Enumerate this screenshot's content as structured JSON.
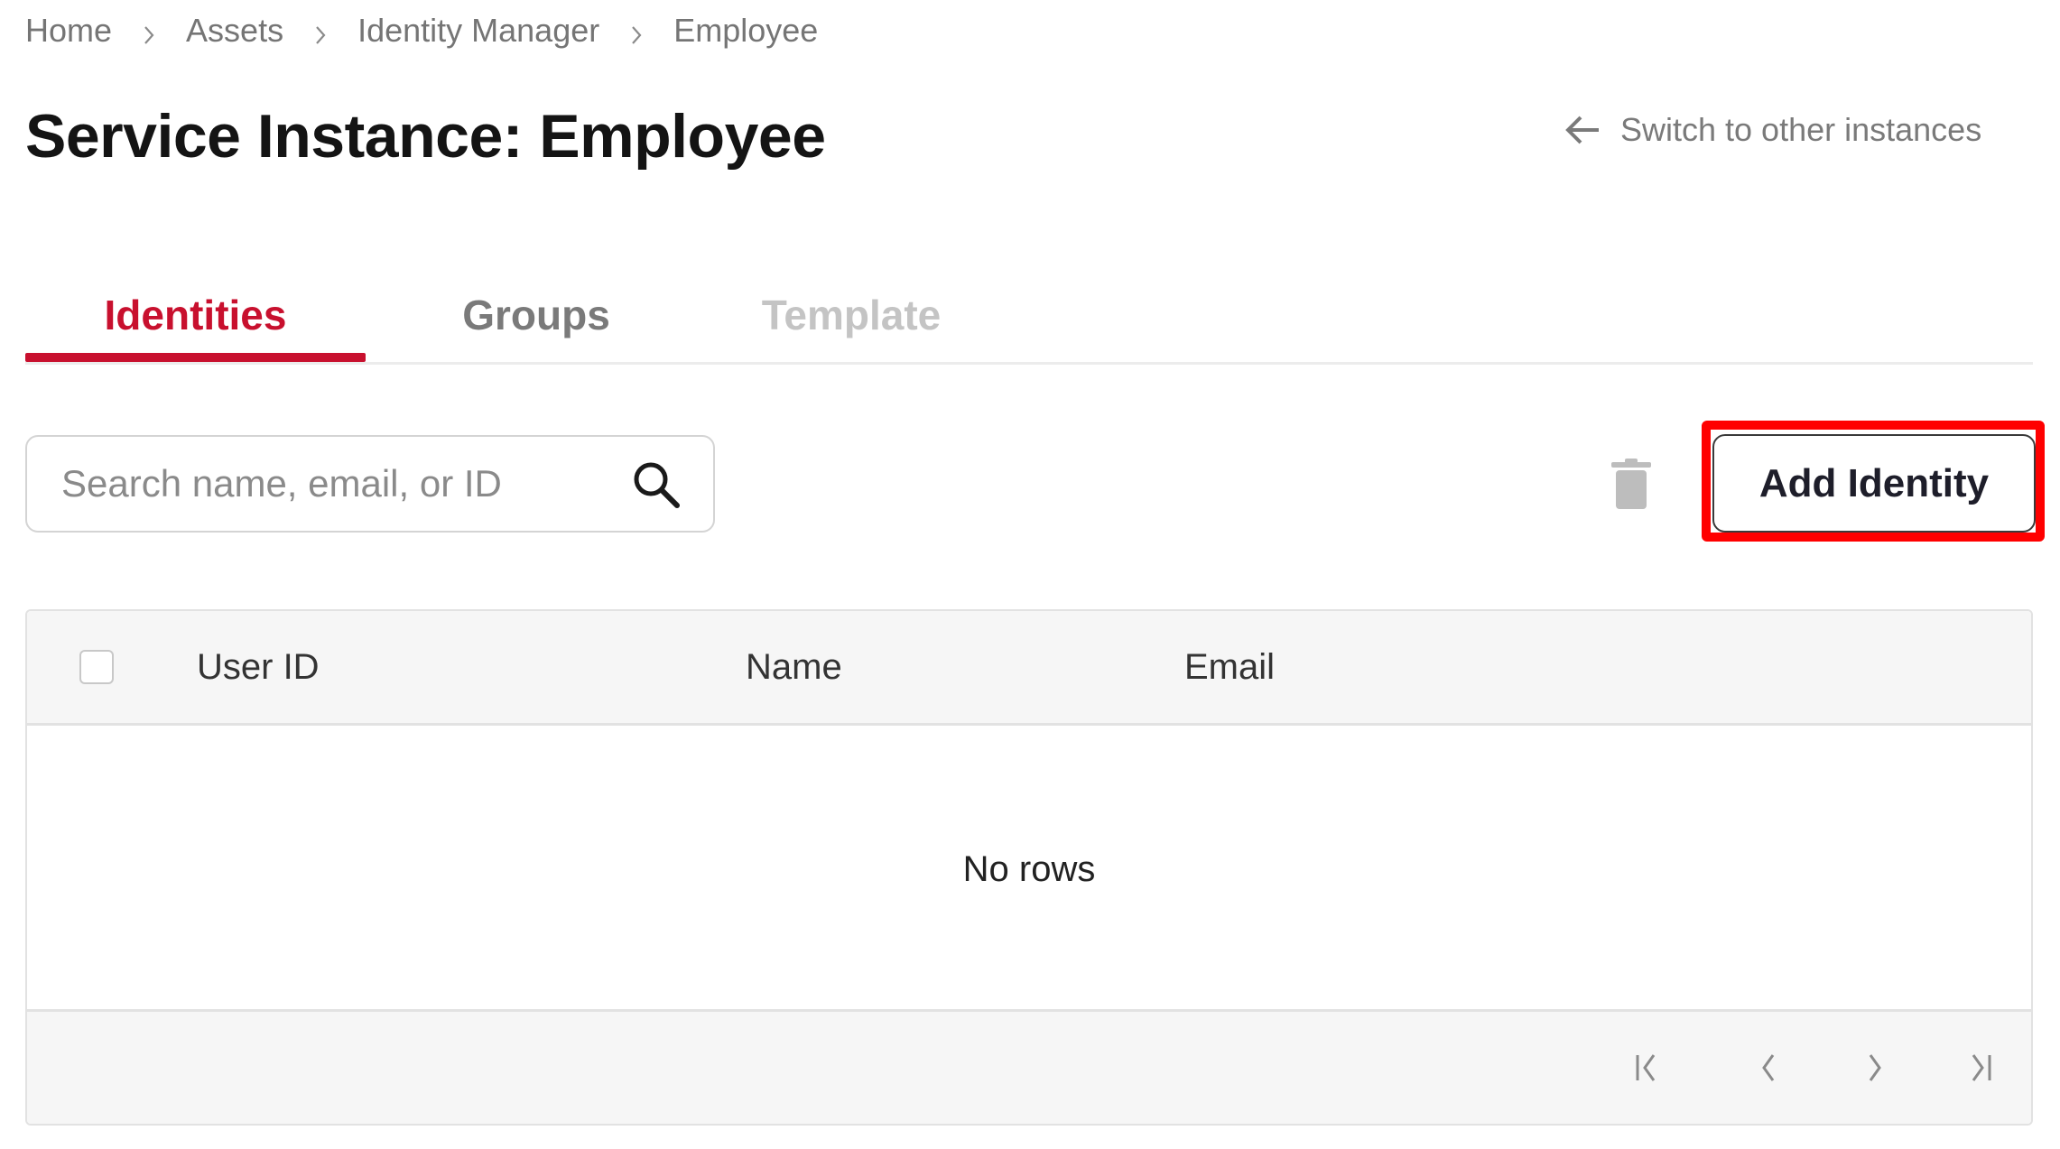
{
  "breadcrumb": {
    "items": [
      {
        "label": "Home"
      },
      {
        "label": "Assets"
      },
      {
        "label": "Identity Manager"
      },
      {
        "label": "Employee"
      }
    ],
    "separator_icon": "chevron-right-icon"
  },
  "header": {
    "title": "Service Instance: Employee",
    "switch_link": {
      "label": "Switch to other instances",
      "icon": "arrow-left-icon"
    }
  },
  "tabs": [
    {
      "label": "Identities",
      "state": "active"
    },
    {
      "label": "Groups",
      "state": "inactive"
    },
    {
      "label": "Template",
      "state": "disabled"
    }
  ],
  "toolbar": {
    "search": {
      "placeholder": "Search name, email, or ID",
      "value": "",
      "icon": "search-icon"
    },
    "delete_icon": "trash-icon",
    "add_button_label": "Add Identity"
  },
  "table": {
    "columns": [
      "User ID",
      "Name",
      "Email"
    ],
    "rows": [],
    "empty_message": "No rows",
    "pagination": {
      "first_icon": "first-page-icon",
      "prev_icon": "previous-page-icon",
      "next_icon": "next-page-icon",
      "last_icon": "last-page-icon"
    }
  },
  "colors": {
    "accent": "#c8102e",
    "highlight": "#ff0000",
    "muted_text": "#757575",
    "disabled_text": "#c4c4c4",
    "table_header_bg": "#f6f6f6"
  }
}
